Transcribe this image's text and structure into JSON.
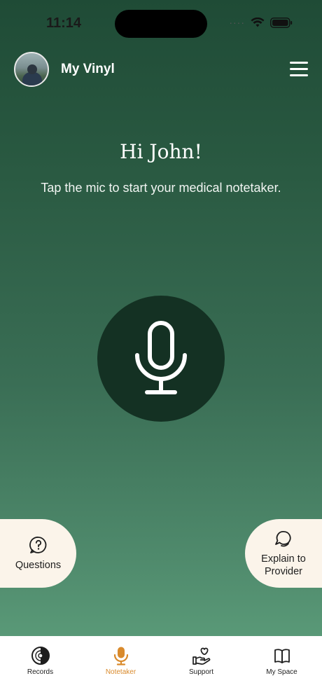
{
  "status_bar": {
    "time": "11:14"
  },
  "header": {
    "app_name": "My Vinyl"
  },
  "main": {
    "greeting": "Hi John!",
    "subtitle": "Tap the mic to start your medical notetaker."
  },
  "actions": {
    "questions_label": "Questions",
    "explain_label": "Explain to Provider"
  },
  "tabs": [
    {
      "label": "Records",
      "icon": "vinyl-record-icon"
    },
    {
      "label": "Notetaker",
      "icon": "microphone-icon",
      "active": true
    },
    {
      "label": "Support",
      "icon": "heart-hand-icon"
    },
    {
      "label": "My Space",
      "icon": "book-icon"
    }
  ],
  "colors": {
    "accent": "#d98a2c",
    "mic_bg": "#143123",
    "pill_bg": "#fbf4ea"
  }
}
